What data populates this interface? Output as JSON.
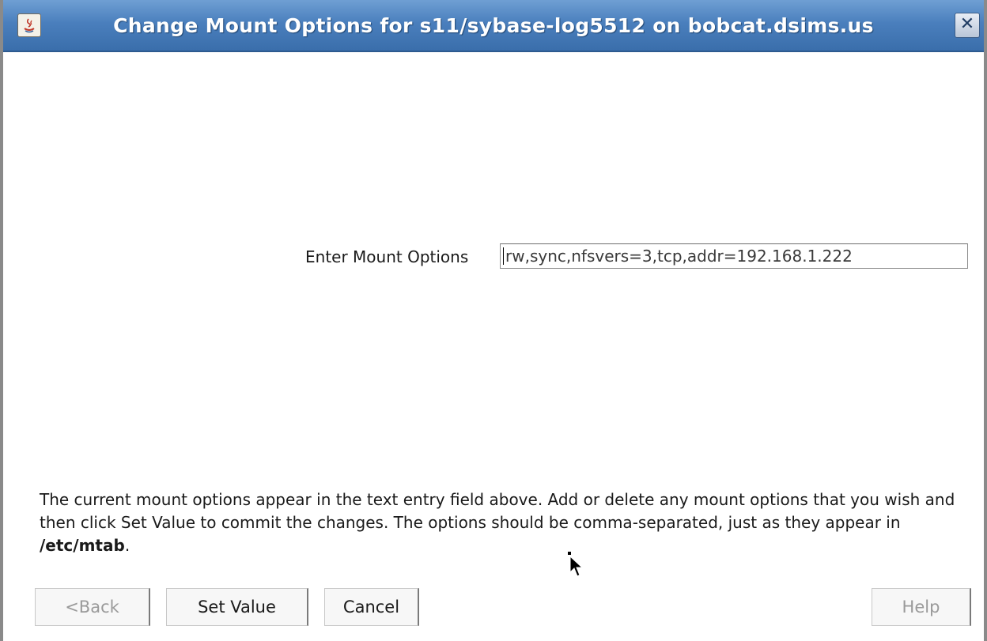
{
  "window": {
    "title": "Change Mount Options for s11/sybase-log5512 on bobcat.dsims.us",
    "close_symbol": "✕",
    "app_icon": "java-icon"
  },
  "form": {
    "label": "Enter Mount Options",
    "value": "rw,sync,nfsvers=3,tcp,addr=192.168.1.222"
  },
  "help": {
    "text": "The current mount options appear in the text entry field above. Add or delete any mount options that you wish and then click Set Value to commit the changes. The options should be comma-separated, just as they appear in ",
    "path": "/etc/mtab",
    "suffix": "."
  },
  "buttons": {
    "back": "<Back",
    "set_value": "Set Value",
    "cancel": "Cancel",
    "help": "Help"
  },
  "colors": {
    "titlebar": "#4a7fbd",
    "disabled_text": "#9a9a9a"
  }
}
